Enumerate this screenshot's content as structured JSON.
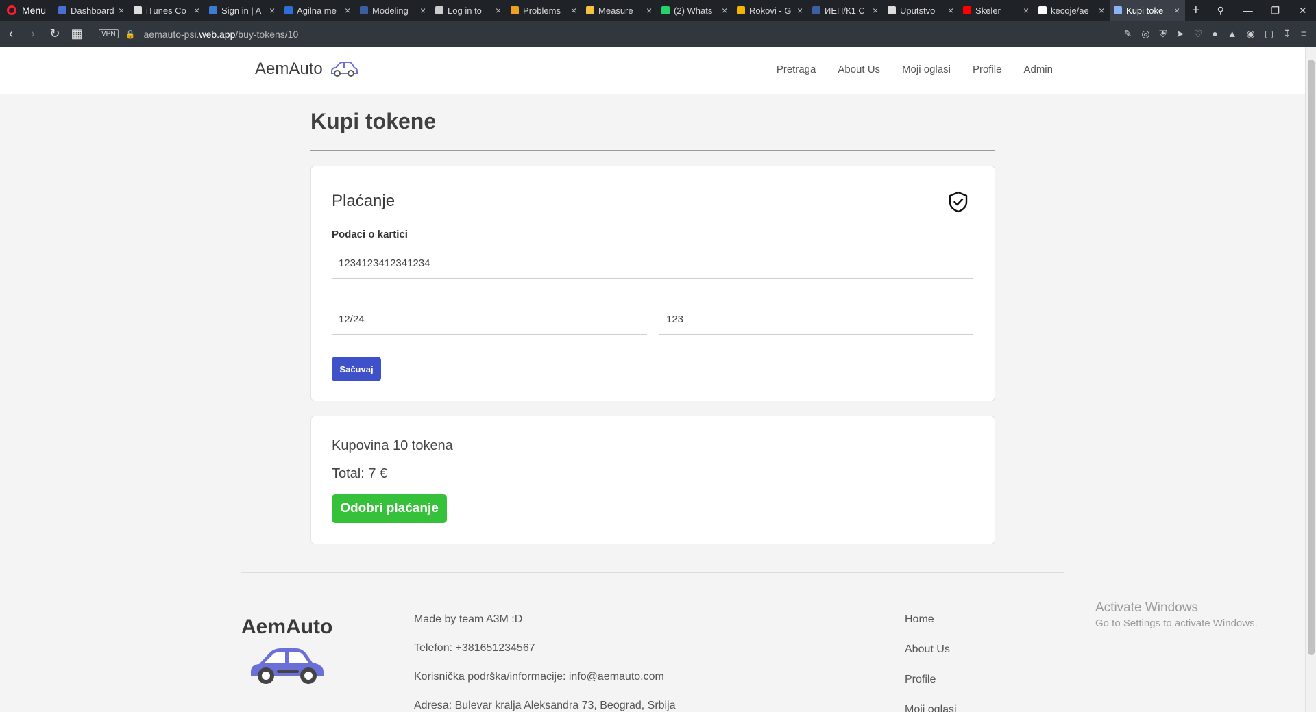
{
  "browser": {
    "menu_label": "Menu",
    "tabs": [
      {
        "label": "Dashboard",
        "color": "#4a6fd1"
      },
      {
        "label": "iTunes Co",
        "color": "#dddddd"
      },
      {
        "label": "Sign in | A",
        "color": "#3a7bd5"
      },
      {
        "label": "Agilna me",
        "color": "#2d6fd6"
      },
      {
        "label": "Modeling",
        "color": "#3b5fa0"
      },
      {
        "label": "Log in to",
        "color": "#cccccc"
      },
      {
        "label": "Problems",
        "color": "#f0a020"
      },
      {
        "label": "Measure",
        "color": "#f5c242"
      },
      {
        "label": "(2) Whats",
        "color": "#25d366"
      },
      {
        "label": "Rokovi - G",
        "color": "#f4b400"
      },
      {
        "label": "ИЕП/К1 C",
        "color": "#3b5fa0"
      },
      {
        "label": "Uputstvo",
        "color": "#dddddd"
      },
      {
        "label": "Skeler",
        "color": "#ff0000"
      },
      {
        "label": "kecoje/ae",
        "color": "#ffffff"
      },
      {
        "label": "Kupi toke",
        "color": "#8ab4f8"
      }
    ],
    "new_tab": "+",
    "url_prefix": "aemauto-psi.",
    "url_domain": "web.app",
    "url_path": "/buy-tokens/10",
    "vpn_label": "VPN"
  },
  "nav": {
    "brand": "AemAuto",
    "links": [
      "Pretraga",
      "About Us",
      "Moji oglasi",
      "Profile",
      "Admin"
    ]
  },
  "page": {
    "title": "Kupi tokene"
  },
  "payment": {
    "title": "Plaćanje",
    "card_label": "Podaci o kartici",
    "card_number": "1234123412341234",
    "expiry": "12/24",
    "cvc": "123",
    "save_label": "Sačuvaj"
  },
  "summary": {
    "purchase_text": "Kupovina 10 tokena",
    "total_text": "Total: 7 €",
    "approve_label": "Odobri plaćanje"
  },
  "footer": {
    "brand": "AemAuto",
    "info": [
      "Made by team A3M :D",
      "Telefon: +381651234567",
      "Korisnička podrška/informacije: info@aemauto.com",
      "Adresa: Bulevar kralja Aleksandra 73, Beograd, Srbija"
    ],
    "links": [
      "Home",
      "About Us",
      "Profile",
      "Moji oglasi"
    ]
  },
  "watermark": {
    "line1": "Activate Windows",
    "line2": "Go to Settings to activate Windows."
  },
  "colors": {
    "save_button": "#3f51c8",
    "approve_button": "#35c13a",
    "car_icon": "#6b6fd8"
  }
}
